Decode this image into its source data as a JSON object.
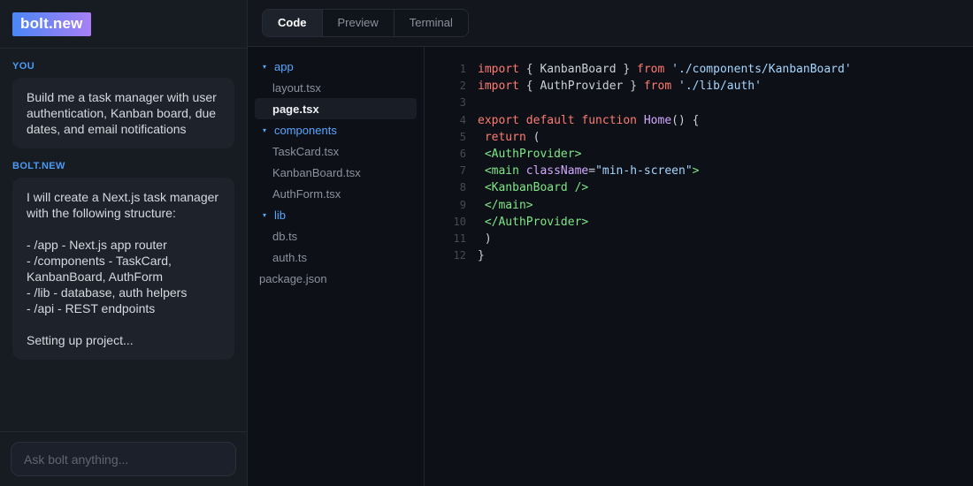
{
  "sidebar": {
    "logo": "bolt.new",
    "messages": [
      {
        "role": "YOU",
        "lines": [
          "Build me a task manager with user authentication, Kanban board, due dates, and email notifications"
        ]
      },
      {
        "role": "BOLT.NEW",
        "lines": [
          "I will create a Next.js task manager with the following structure:",
          "",
          "- /app - Next.js app router",
          "- /components - TaskCard, KanbanBoard, AuthForm",
          "- /lib - database, auth helpers",
          "- /api - REST endpoints",
          "",
          "Setting up project..."
        ]
      }
    ],
    "input_placeholder": "Ask bolt anything..."
  },
  "tabs": [
    {
      "label": "Code",
      "active": true
    },
    {
      "label": "Preview",
      "active": false
    },
    {
      "label": "Terminal",
      "active": false
    }
  ],
  "file_tree": [
    {
      "name": "app",
      "type": "folder",
      "depth": 0,
      "expanded": true,
      "selected": false
    },
    {
      "name": "layout.tsx",
      "type": "file",
      "depth": 1,
      "selected": false
    },
    {
      "name": "page.tsx",
      "type": "file",
      "depth": 1,
      "selected": true
    },
    {
      "name": "components",
      "type": "folder",
      "depth": 0,
      "expanded": true,
      "selected": false
    },
    {
      "name": "TaskCard.tsx",
      "type": "file",
      "depth": 1,
      "selected": false
    },
    {
      "name": "KanbanBoard.tsx",
      "type": "file",
      "depth": 1,
      "selected": false
    },
    {
      "name": "AuthForm.tsx",
      "type": "file",
      "depth": 1,
      "selected": false
    },
    {
      "name": "lib",
      "type": "folder",
      "depth": 0,
      "expanded": true,
      "selected": false
    },
    {
      "name": "db.ts",
      "type": "file",
      "depth": 1,
      "selected": false
    },
    {
      "name": "auth.ts",
      "type": "file",
      "depth": 1,
      "selected": false
    },
    {
      "name": "package.json",
      "type": "file",
      "depth": 0,
      "selected": false
    }
  ],
  "editor": {
    "lines": [
      {
        "num": "1",
        "tokens": [
          [
            "k",
            "import"
          ],
          [
            "p",
            " { KanbanBoard } "
          ],
          [
            "k",
            "from"
          ],
          [
            "p",
            " "
          ],
          [
            "s",
            "'./components/KanbanBoard'"
          ]
        ]
      },
      {
        "num": "2",
        "tokens": [
          [
            "k",
            "import"
          ],
          [
            "p",
            " { AuthProvider } "
          ],
          [
            "k",
            "from"
          ],
          [
            "p",
            " "
          ],
          [
            "s",
            "'./lib/auth'"
          ]
        ]
      },
      {
        "num": "3",
        "tokens": []
      },
      {
        "num": "4",
        "tokens": [
          [
            "k",
            "export default function"
          ],
          [
            "p",
            " "
          ],
          [
            "f",
            "Home"
          ],
          [
            "p",
            "() {"
          ]
        ]
      },
      {
        "num": "5",
        "tokens": [
          [
            "p",
            " "
          ],
          [
            "k",
            "return"
          ],
          [
            "p",
            " ("
          ]
        ]
      },
      {
        "num": "6",
        "tokens": [
          [
            "p",
            " "
          ],
          [
            "t",
            "<AuthProvider>"
          ]
        ]
      },
      {
        "num": "7",
        "tokens": [
          [
            "p",
            " "
          ],
          [
            "t",
            "<main"
          ],
          [
            "p",
            " "
          ],
          [
            "a",
            "className"
          ],
          [
            "p",
            "="
          ],
          [
            "s",
            "\"min-h-screen\""
          ],
          [
            "t",
            ">"
          ]
        ]
      },
      {
        "num": "8",
        "tokens": [
          [
            "p",
            " "
          ],
          [
            "t",
            "<KanbanBoard />"
          ]
        ]
      },
      {
        "num": "9",
        "tokens": [
          [
            "p",
            " "
          ],
          [
            "t",
            "</main>"
          ]
        ]
      },
      {
        "num": "10",
        "tokens": [
          [
            "p",
            " "
          ],
          [
            "t",
            "</AuthProvider>"
          ]
        ]
      },
      {
        "num": "11",
        "tokens": [
          [
            "p",
            " )"
          ]
        ]
      },
      {
        "num": "12",
        "tokens": [
          [
            "p",
            "}"
          ]
        ]
      }
    ]
  },
  "colors": {
    "accent_blue": "#4b9af5",
    "logo_gradient_start": "#4a86f7",
    "logo_gradient_end": "#a87ff5",
    "folder_blue": "#58a6ff",
    "keyword_red": "#ff7b72",
    "string_blue": "#a5d6ff",
    "tag_green": "#7ee787",
    "attr_purple": "#d2a8ff",
    "editor_bg": "#0d1016",
    "sidebar_bg": "#171b22"
  }
}
